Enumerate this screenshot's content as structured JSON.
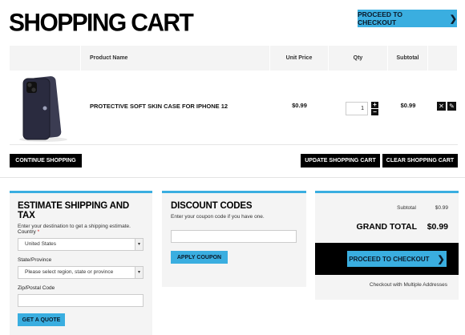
{
  "header": {
    "title": "SHOPPING CART",
    "checkout_label": "PROCEED TO CHECKOUT"
  },
  "table": {
    "columns": [
      "Product Name",
      "Unit Price",
      "Qty",
      "Subtotal"
    ],
    "rows": [
      {
        "name": "PROTECTIVE SOFT SKIN CASE FOR IPHONE 12",
        "unit_price": "$0.99",
        "qty": "1",
        "subtotal": "$0.99"
      }
    ]
  },
  "cart_actions": {
    "continue": "CONTINUE SHOPPING",
    "update": "UPDATE SHOPPING CART",
    "clear": "CLEAR SHOPPING CART"
  },
  "shipping": {
    "title": "ESTIMATE SHIPPING AND TAX",
    "desc": "Enter your destination to get a shipping estimate.",
    "country_label": "Country",
    "required_mark": "*",
    "country_value": "United States",
    "region_label": "State/Province",
    "region_value": "Please select region, state or province",
    "zip_label": "Zip/Postal Code",
    "zip_value": "",
    "button": "GET A QUOTE"
  },
  "discount": {
    "title": "DISCOUNT CODES",
    "desc": "Enter your coupon code if you have one.",
    "code_value": "",
    "button": "APPLY COUPON"
  },
  "totals": {
    "subtotal_label": "Subtotal",
    "subtotal_value": "$0.99",
    "grand_label": "GRAND TOTAL",
    "grand_value": "$0.99",
    "checkout_label": "PROCEED TO CHECKOUT",
    "multi_label": "Checkout with Multiple Addresses"
  },
  "icons": {
    "checkout_chevron": "chevron-right-icon",
    "remove": "close-icon",
    "edit": "pencil-icon",
    "qty_up": "plus-icon",
    "qty_down": "minus-icon",
    "select_arrow": "chevron-down-icon"
  },
  "colors": {
    "accent": "#3aaee0",
    "dark": "#000000",
    "panel_bg": "#f4f4f4",
    "required": "#dd2222"
  }
}
